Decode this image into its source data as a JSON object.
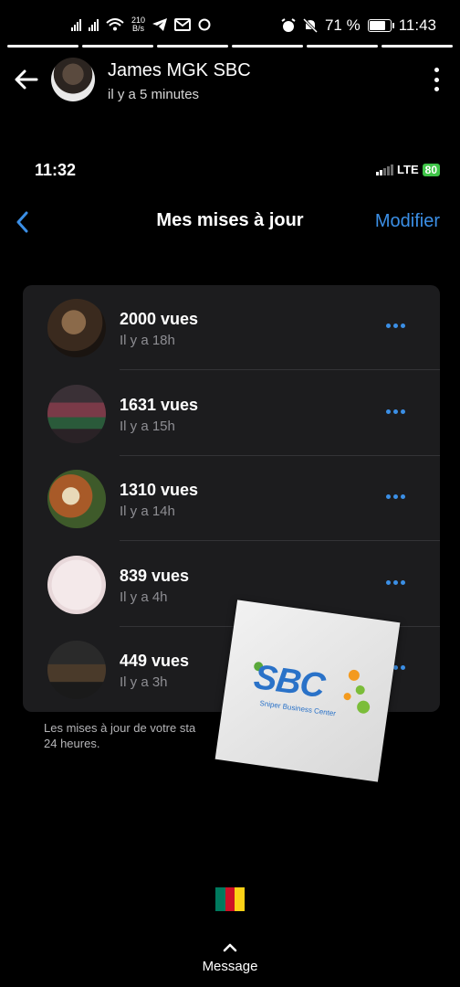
{
  "status_bar": {
    "net_speed_value": "210",
    "net_speed_unit": "B/s",
    "battery_percent_text": "71 %",
    "battery_level": 0.71,
    "time": "11:43"
  },
  "story_progress": {
    "segments": 6,
    "active_segment": 6
  },
  "header": {
    "sender_name": "James MGK SBC",
    "posted_time": "il y a 5 minutes"
  },
  "inner_screen": {
    "time": "11:32",
    "network": "LTE",
    "battery": "80",
    "title": "Mes mises à jour",
    "edit_label": "Modifier",
    "updates": [
      {
        "views": "2000 vues",
        "ago": "Il y a 18h"
      },
      {
        "views": "1631 vues",
        "ago": "Il y a 15h"
      },
      {
        "views": "1310 vues",
        "ago": "Il y a 14h"
      },
      {
        "views": "839 vues",
        "ago": "Il y a 4h"
      },
      {
        "views": "449 vues",
        "ago": "Il y a 3h"
      }
    ],
    "footer_note": "Les mises à jour de votre sta\n24 heures."
  },
  "sticker": {
    "logo_text": "SBC",
    "tagline": "Sniper Business Center"
  },
  "bottom": {
    "flag_icon": "cameroon-flag",
    "flag_colors": [
      "#007a5e",
      "#ce1126",
      "#fcd116"
    ],
    "reply_label": "Message"
  },
  "colors": {
    "accent": "#3b8fe6",
    "card_bg": "#1c1c1e",
    "battery_green": "#3fc548"
  }
}
